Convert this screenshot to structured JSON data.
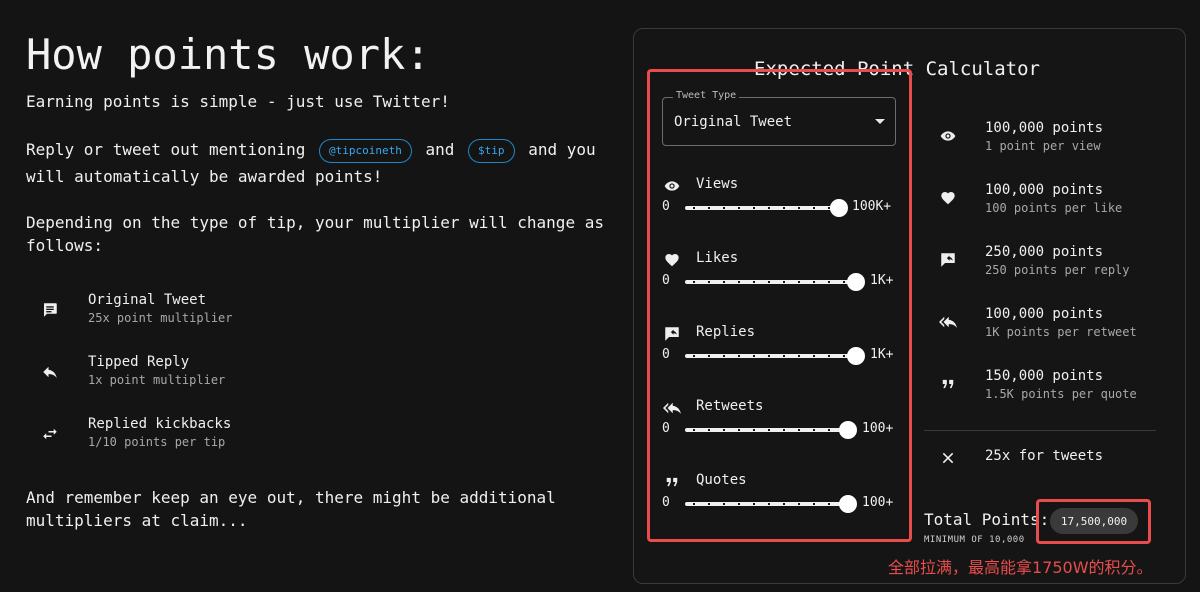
{
  "heading": "How points work:",
  "intro": "Earning points is simple - just use Twitter!",
  "mention": {
    "prefix": "Reply or tweet out mentioning",
    "handle": "@tipcoineth",
    "and": "and",
    "ticker": "$tip",
    "suffix_line1": "and you",
    "line2": "will automatically be awarded points!"
  },
  "depending_line1": "Depending on the type of tip, your multiplier will change as",
  "depending_line2": "follows:",
  "multipliers": [
    {
      "icon": "comment-icon",
      "title": "Original Tweet",
      "sub": "25x point multiplier"
    },
    {
      "icon": "reply-icon",
      "title": "Tipped Reply",
      "sub": "1x point multiplier"
    },
    {
      "icon": "swap-icon",
      "title": "Replied kickbacks",
      "sub": "1/10 points per tip"
    }
  ],
  "remember_line1": "And remember keep an eye out, there might be additional",
  "remember_line2": "multipliers at claim...",
  "calculator": {
    "title": "Expected Point Calculator",
    "tweet_type_label": "Tweet Type",
    "tweet_type_value": "Original Tweet",
    "sliders": [
      {
        "icon": "eye-icon",
        "name": "Views",
        "min": "0",
        "max": "100K+",
        "level": 1.0
      },
      {
        "icon": "heart-icon",
        "name": "Likes",
        "min": "0",
        "max": "1K+",
        "level": 1.0
      },
      {
        "icon": "reply-comment-icon",
        "name": "Replies",
        "min": "0",
        "max": "1K+",
        "level": 1.0
      },
      {
        "icon": "reply-all-icon",
        "name": "Retweets",
        "min": "0",
        "max": "100+",
        "level": 1.0
      },
      {
        "icon": "quote-icon",
        "name": "Quotes",
        "min": "0",
        "max": "100+",
        "level": 1.0
      }
    ],
    "results": [
      {
        "icon": "eye-icon",
        "value": "100,000 points",
        "sub": "1 point per view"
      },
      {
        "icon": "heart-icon",
        "value": "100,000 points",
        "sub": "100 points per like"
      },
      {
        "icon": "reply-comment-icon",
        "value": "250,000 points",
        "sub": "250 points per reply"
      },
      {
        "icon": "reply-all-icon",
        "value": "100,000 points",
        "sub": "1K points per retweet"
      },
      {
        "icon": "quote-icon",
        "value": "150,000 points",
        "sub": "1.5K points per quote"
      }
    ],
    "multiplier_text": "25x for tweets",
    "total_label": "Total Points:",
    "total_value": "17,500,000",
    "minimum": "MINIMUM OF 10,000"
  },
  "annotation": "全部拉满，最高能拿1750W的积分。",
  "colors": {
    "accent_chip": "#1e88c8",
    "highlight": "#e84c4c",
    "background": "#141414"
  }
}
